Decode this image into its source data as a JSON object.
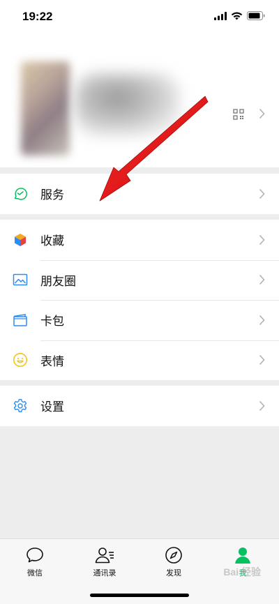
{
  "status_bar": {
    "time": "19:22"
  },
  "profile": {
    "qr_icon": "qr-code-icon",
    "chevron": "chevron-right-icon"
  },
  "services": {
    "label": "服务",
    "icon": "service-icon",
    "icon_color": "#07c160"
  },
  "menu": [
    {
      "label": "收藏",
      "icon": "favorites-cube-icon"
    },
    {
      "label": "朋友圈",
      "icon": "moments-image-icon"
    },
    {
      "label": "卡包",
      "icon": "card-wallet-icon"
    },
    {
      "label": "表情",
      "icon": "sticker-smile-icon"
    }
  ],
  "settings": {
    "label": "设置",
    "icon": "gear-icon"
  },
  "tabs": [
    {
      "label": "微信",
      "icon": "chat-bubble-icon"
    },
    {
      "label": "通讯录",
      "icon": "contacts-icon"
    },
    {
      "label": "发现",
      "icon": "compass-icon"
    },
    {
      "label": "我",
      "icon": "me-person-icon",
      "active": true
    }
  ],
  "colors": {
    "accent": "#07c160",
    "annotation_arrow": "#e01414",
    "background": "#ededed"
  }
}
